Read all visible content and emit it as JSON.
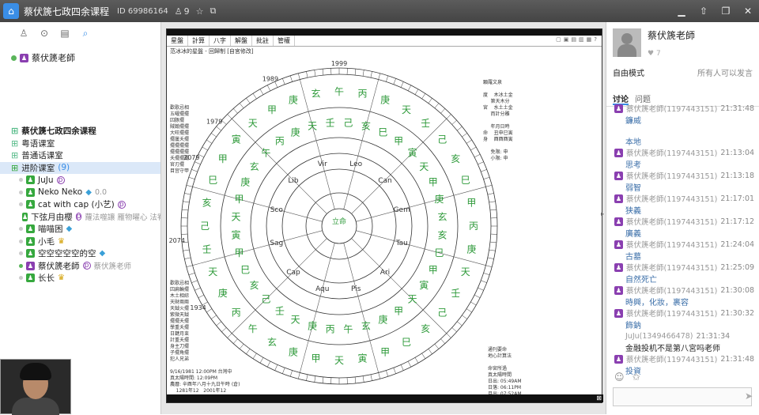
{
  "titlebar": {
    "room_title": "蔡伏篪七政四余课程",
    "room_id": "ID 69986164",
    "user_count": "9",
    "window_buttons": [
      "minimize",
      "up",
      "restore",
      "close"
    ]
  },
  "left": {
    "tools": [
      "person-icon",
      "location-icon",
      "doc-icon",
      "search-icon"
    ],
    "host": "蔡伏篪老師",
    "tree": [
      {
        "label": "蔡伏篪七政四余课程",
        "type": "root"
      },
      {
        "label": "粤语课室",
        "type": "channel"
      },
      {
        "label": "普通话课室",
        "type": "channel"
      },
      {
        "label": "进阶课室",
        "count": "(9)",
        "type": "channel-active"
      }
    ],
    "members": [
      {
        "name": "JuJu",
        "extra": ""
      },
      {
        "name": "Neko Neko",
        "extra": "0.0"
      },
      {
        "name": "cat with cap (小艺)",
        "extra": ""
      },
      {
        "name": "下弦月由櫻",
        "extra": "蘿法噬讓 雁物曜心 法宥"
      },
      {
        "name": "喵喵困",
        "extra": ""
      },
      {
        "name": "小毛",
        "extra": ""
      },
      {
        "name": "空空空空空的空",
        "extra": ""
      },
      {
        "name": "蔡伏篪老師",
        "extra": "蔡伏篪老师"
      },
      {
        "name": "长长",
        "extra": ""
      }
    ]
  },
  "center": {
    "menu": [
      "星盤",
      "計算",
      "八字",
      "解盤",
      "批註",
      "管權"
    ],
    "subtitle": "范冰冰的星盤 - 回歸制    [自宮修改]",
    "left_notes": "歡歌忌相\n五曜擺擺\n囚豚擺\n賊翰擺擺\n大旺擺擺\n擺屢夭擺\n擺擺擺擺\n擺擺擺擺\n夭擺擺擺\n官刃擺\n目宫守甲",
    "left_notes2": "歡歌忌相\n囚扁輪擺\n木土相綜\n天財兩兩\n天鉞火擺\n紫微天鉞\n擺擺夭擺\n學重夭擺\n日鍵月束\n計重夭擺\n身主刀擺\n子擺角擺\n犯人兄弟",
    "right_notes": "顆羅文泉\n\n度    木冰土金\n     第天木分\n宮    水土土金\n     而計分雕\n\n     年月日時\n命    丑申巳寅\n身    酉酉酉寅\n\n     免限: 申\n     小限: 申",
    "bottom_notes": "9/16/1981 12:00PM 台灣中\n真太陽時間: 12:09PM\n農曆: 辛酉年八月十九日午時 (倉)\n    1281年12   2001年12",
    "bottom_right_notes": "通刊要命\n地心計算法\n\n命宮所過\n真太陽時間\n日出: 05:49AM\n日落: 06:11PM\n月出: 07:52AM\n月落: 08:17PM",
    "year_labels": [
      "1999",
      "1989",
      "1979",
      "2079",
      "2074",
      "1934"
    ],
    "outer_chars": "丙庚天壬己亥巳甲寅天甲庚玄午",
    "zodiac": [
      "Leo",
      "Can",
      "Gem",
      "Tau",
      "Ari",
      "Pis",
      "Aqu",
      "Cap",
      "Sag",
      "Sco",
      "Lib",
      "Vir"
    ]
  },
  "right": {
    "profile_name": "蔡伏篪老師",
    "likes": "7",
    "mode": "自由模式",
    "mode_right": "所有人可以发言",
    "tabs": [
      "讨论",
      "问题"
    ],
    "messages": [
      {
        "sender": "蔡伏篪老師(1197443151)",
        "time": "21:31:48",
        "text": "鐮威"
      },
      {
        "sender": "",
        "time": "",
        "text": "本地"
      },
      {
        "sender": "蔡伏篪老師(1197443151)",
        "time": "21:13:04",
        "text": "思考"
      },
      {
        "sender": "蔡伏篪老師(1197443151)",
        "time": "21:13:18",
        "text": "弱智"
      },
      {
        "sender": "蔡伏篪老師(1197443151)",
        "time": "21:17:01",
        "text": "狭義"
      },
      {
        "sender": "蔡伏篪老師(1197443151)",
        "time": "21:17:12",
        "text": "廣義"
      },
      {
        "sender": "蔡伏篪老師(1197443151)",
        "time": "21:24:04",
        "text": "古墓"
      },
      {
        "sender": "蔡伏篪老師(1197443151)",
        "time": "21:25:09",
        "text": "自然死亡"
      },
      {
        "sender": "蔡伏篪老師(1197443151)",
        "time": "21:30:08",
        "text": "時興，化妝，裹容"
      },
      {
        "sender": "蔡伏篪老師(1197443151)",
        "time": "21:30:32",
        "text": "飾鈉"
      },
      {
        "sender": "JuJu(1349466478)",
        "time": "21:31:34",
        "text": "金融投机不是第八宮吗老师"
      },
      {
        "sender": "蔡伏篪老師(1197443151)",
        "time": "21:31:48",
        "text": "投資"
      }
    ]
  }
}
